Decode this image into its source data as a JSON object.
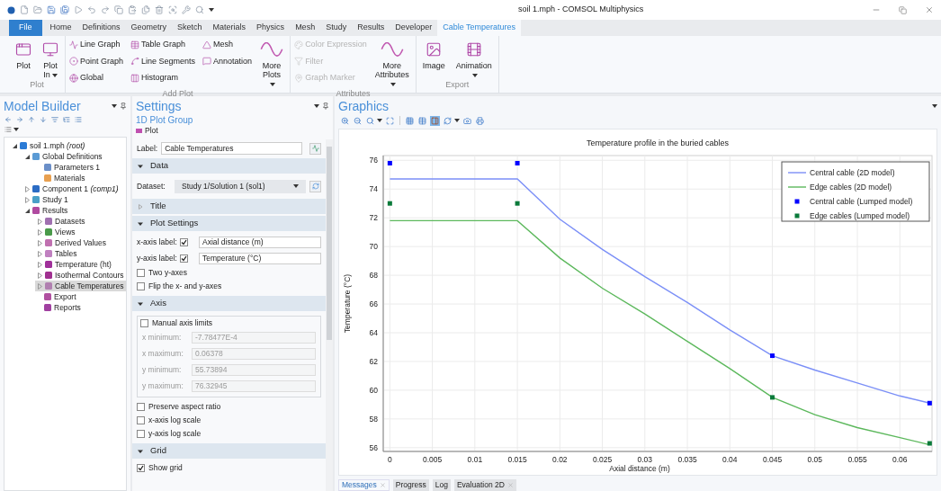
{
  "window": {
    "title": "soil 1.mph - COMSOL Multiphysics"
  },
  "ribbon_tabs": [
    {
      "label": "File",
      "kind": "file",
      "selected": false
    },
    {
      "label": "Home",
      "kind": "tab",
      "selected": false
    },
    {
      "label": "Definitions",
      "kind": "tab",
      "selected": false
    },
    {
      "label": "Geometry",
      "kind": "tab",
      "selected": false
    },
    {
      "label": "Sketch",
      "kind": "tab",
      "selected": false
    },
    {
      "label": "Materials",
      "kind": "tab",
      "selected": false
    },
    {
      "label": "Physics",
      "kind": "tab",
      "selected": false
    },
    {
      "label": "Mesh",
      "kind": "tab",
      "selected": false
    },
    {
      "label": "Study",
      "kind": "tab",
      "selected": false
    },
    {
      "label": "Results",
      "kind": "tab",
      "selected": false
    },
    {
      "label": "Developer",
      "kind": "tab",
      "selected": false
    },
    {
      "label": "Cable Temperatures",
      "kind": "tab",
      "selected": true
    }
  ],
  "ribbon_groups": [
    {
      "label": "Plot",
      "items": [
        {
          "label": "Plot",
          "kind": "large",
          "disabled": false,
          "dropdown": false
        },
        {
          "label": "Plot In",
          "kind": "large",
          "disabled": false,
          "dropdown": true
        }
      ]
    },
    {
      "label": "Add Plot",
      "items": [
        {
          "label": "Line Graph",
          "kind": "small",
          "disabled": false
        },
        {
          "label": "Point Graph",
          "kind": "small",
          "disabled": false
        },
        {
          "label": "Global",
          "kind": "small",
          "disabled": false
        },
        {
          "label": "Table Graph",
          "kind": "small",
          "disabled": false
        },
        {
          "label": "Line Segments",
          "kind": "small",
          "disabled": false
        },
        {
          "label": "Histogram",
          "kind": "small",
          "disabled": false
        },
        {
          "label": "Mesh",
          "kind": "small",
          "disabled": false
        },
        {
          "label": "Annotation",
          "kind": "small",
          "disabled": false
        },
        {
          "label": "More Plots",
          "kind": "large",
          "disabled": false,
          "dropdown": true
        }
      ]
    },
    {
      "label": "Attributes",
      "items": [
        {
          "label": "Color Expression",
          "kind": "small",
          "disabled": true
        },
        {
          "label": "Filter",
          "kind": "small",
          "disabled": true
        },
        {
          "label": "Graph Marker",
          "kind": "small",
          "disabled": true
        },
        {
          "label": "More Attributes",
          "kind": "large",
          "disabled": false,
          "dropdown": true
        }
      ]
    },
    {
      "label": "Export",
      "items": [
        {
          "label": "Image",
          "kind": "large",
          "disabled": false,
          "dropdown": false
        },
        {
          "label": "Animation",
          "kind": "large",
          "disabled": false,
          "dropdown": true
        }
      ]
    }
  ],
  "model_builder": {
    "title": "Model Builder",
    "tree": [
      {
        "label": "soil 1.mph *(root)*",
        "kind": "branch",
        "expanded": true,
        "selected": false,
        "color": "#2b7bd6",
        "children": [
          {
            "label": "Global Definitions",
            "kind": "branch",
            "expanded": true,
            "selected": false,
            "color": "#5b9bd5",
            "children": [
              {
                "label": "Parameters 1",
                "kind": "leaf",
                "selected": false,
                "color": "#6b8fc8"
              },
              {
                "label": "Materials",
                "kind": "leaf",
                "selected": false,
                "color": "#e8a050"
              }
            ]
          },
          {
            "label": "Component 1 *(comp1)*",
            "kind": "branch",
            "expanded": false,
            "selected": false,
            "color": "#2b6cc4"
          },
          {
            "label": "Study 1",
            "kind": "branch",
            "expanded": false,
            "selected": false,
            "color": "#4aa0c8"
          },
          {
            "label": "Results",
            "kind": "branch",
            "expanded": true,
            "selected": false,
            "color": "#b04aa0",
            "children": [
              {
                "label": "Datasets",
                "kind": "branch",
                "expanded": false,
                "selected": false,
                "color": "#a070b0"
              },
              {
                "label": "Views",
                "kind": "branch",
                "expanded": false,
                "selected": false,
                "color": "#4a9a4a"
              },
              {
                "label": "Derived Values",
                "kind": "branch",
                "expanded": false,
                "selected": false,
                "color": "#c070b0"
              },
              {
                "label": "Tables",
                "kind": "branch",
                "expanded": false,
                "selected": false,
                "color": "#c080c0"
              },
              {
                "label": "Temperature (ht)",
                "kind": "branch",
                "expanded": false,
                "selected": false,
                "color": "#a0309a"
              },
              {
                "label": "Isothermal Contours",
                "kind": "branch",
                "expanded": false,
                "selected": false,
                "color": "#a03090"
              },
              {
                "label": "Cable Temperatures",
                "kind": "branch",
                "expanded": false,
                "selected": true,
                "color": "#b080b0"
              },
              {
                "label": "Export",
                "kind": "leaf",
                "selected": false,
                "color": "#b050a0"
              },
              {
                "label": "Reports",
                "kind": "leaf",
                "selected": false,
                "color": "#a040a0"
              }
            ]
          }
        ]
      }
    ]
  },
  "settings": {
    "title": "Settings",
    "subtitle": "1D Plot Group",
    "plot_button": "Plot",
    "label_field": {
      "label": "Label:",
      "value": "Cable Temperatures"
    },
    "sections": [
      {
        "title": "Data",
        "expanded": true,
        "rows": [
          {
            "kind": "select",
            "label": "Dataset:",
            "value": "Study 1/Solution 1 (sol1)"
          }
        ]
      },
      {
        "title": "Title",
        "expanded": false
      },
      {
        "title": "Plot Settings",
        "expanded": true,
        "rows": [
          {
            "kind": "checkbox_field",
            "label": "x-axis label:",
            "checked": true,
            "value": "Axial distance (m)"
          },
          {
            "kind": "checkbox_field",
            "label": "y-axis label:",
            "checked": true,
            "value": "Temperature (°C)"
          },
          {
            "kind": "checkbox",
            "label": "Two y-axes",
            "checked": false
          },
          {
            "kind": "checkbox",
            "label": "Flip the x- and y-axes",
            "checked": false
          }
        ]
      },
      {
        "title": "Axis",
        "expanded": true,
        "rows": [
          {
            "kind": "limits",
            "label": "Manual axis limits",
            "checked": false,
            "fields": [
              {
                "label": "x minimum:",
                "value": "-7.78477E-4"
              },
              {
                "label": "x maximum:",
                "value": "0.06378"
              },
              {
                "label": "y minimum:",
                "value": "55.73894"
              },
              {
                "label": "y maximum:",
                "value": "76.32945"
              }
            ]
          },
          {
            "kind": "checkbox",
            "label": "Preserve aspect ratio",
            "checked": false
          },
          {
            "kind": "checkbox",
            "label": "x-axis log scale",
            "checked": false
          },
          {
            "kind": "checkbox",
            "label": "y-axis log scale",
            "checked": false
          }
        ]
      },
      {
        "title": "Grid",
        "expanded": true,
        "rows": [
          {
            "kind": "checkbox",
            "label": "Show grid",
            "checked": true
          }
        ]
      }
    ]
  },
  "graphics": {
    "title": "Graphics",
    "toolbar": [
      {
        "kind": "zoom-in",
        "selected": false,
        "dropdown": false
      },
      {
        "kind": "zoom-out",
        "selected": false,
        "dropdown": false
      },
      {
        "kind": "zoom-box",
        "selected": false,
        "dropdown": true
      },
      {
        "kind": "extents",
        "selected": false,
        "dropdown": false
      },
      {
        "kind": "grid",
        "selected": false,
        "dropdown": false
      },
      {
        "kind": "table",
        "selected": false,
        "dropdown": false
      },
      {
        "kind": "legend",
        "selected": true,
        "dropdown": false
      },
      {
        "kind": "refresh",
        "selected": false,
        "dropdown": true
      },
      {
        "kind": "camera",
        "selected": false,
        "dropdown": false
      },
      {
        "kind": "print",
        "selected": false,
        "dropdown": false
      }
    ],
    "chart_data": {
      "type": "line",
      "title": "Temperature profile in the buried cables",
      "xlabel": "Axial distance (m)",
      "ylabel": "Temperature (°C)",
      "x": [
        0,
        0.005,
        0.01,
        0.015,
        0.02,
        0.025,
        0.03,
        0.035,
        0.04,
        0.045,
        0.05,
        0.055,
        0.06,
        0.0635
      ],
      "series": [
        {
          "name": "Central cable (2D model)",
          "color": "#7b8ff7",
          "type": "line",
          "values": [
            74.7,
            74.7,
            74.7,
            74.7,
            71.9,
            69.8,
            67.9,
            66.1,
            64.2,
            62.4,
            61.4,
            60.5,
            59.6,
            59.1
          ]
        },
        {
          "name": "Edge cables (2D model)",
          "color": "#5cb85c",
          "type": "line",
          "values": [
            71.8,
            71.8,
            71.8,
            71.8,
            69.2,
            67.1,
            65.3,
            63.4,
            61.5,
            59.5,
            58.3,
            57.4,
            56.7,
            56.2
          ]
        },
        {
          "name": "Central cable (Lumped model)",
          "color": "#0000ff",
          "type": "scatter",
          "values": [
            75.8,
            null,
            null,
            75.8,
            null,
            null,
            null,
            null,
            null,
            62.4,
            null,
            null,
            null,
            59.1
          ]
        },
        {
          "name": "Edge cables (Lumped model)",
          "color": "#0a7a3a",
          "type": "scatter",
          "values": [
            73,
            null,
            null,
            73,
            null,
            null,
            null,
            null,
            null,
            59.5,
            null,
            null,
            null,
            56.3
          ]
        }
      ],
      "xlim": [
        -0.000778477,
        0.06378
      ],
      "ylim": [
        55.73894,
        76.32945
      ],
      "xticks": [
        0,
        0.005,
        0.01,
        0.015,
        0.02,
        0.025,
        0.03,
        0.035,
        0.04,
        0.045,
        0.05,
        0.055,
        0.06
      ],
      "yticks": [
        56,
        58,
        60,
        62,
        64,
        66,
        68,
        70,
        72,
        74,
        76
      ],
      "grid": true,
      "legend": "upper right"
    }
  },
  "bottom_tabs": [
    {
      "label": "Messages",
      "selected": true,
      "closable": true
    },
    {
      "label": "Progress",
      "selected": false,
      "closable": false
    },
    {
      "label": "Log",
      "selected": false,
      "closable": false
    },
    {
      "label": "Evaluation 2D",
      "selected": false,
      "closable": true
    }
  ]
}
